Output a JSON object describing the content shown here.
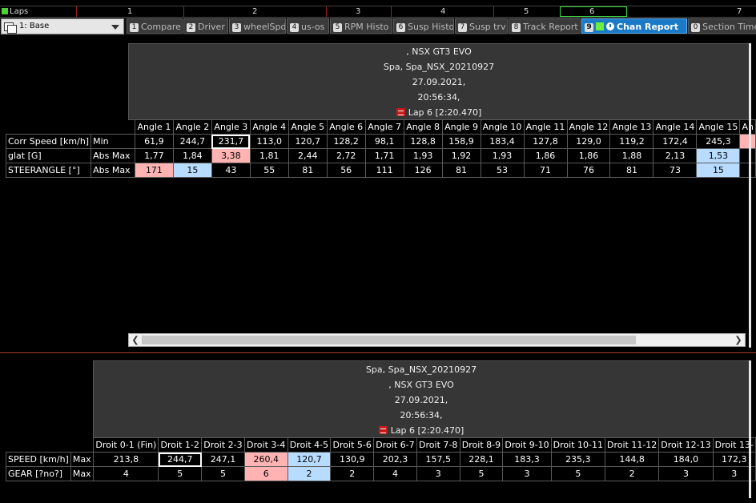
{
  "laps_bar": {
    "label": "Laps",
    "numbers": [
      "1",
      "2",
      "3",
      "4",
      "5",
      "6",
      "7"
    ]
  },
  "toolbar": {
    "config_select": "1: Base",
    "tabs": [
      {
        "num": "1",
        "label": "Compare"
      },
      {
        "num": "2",
        "label": "Driver"
      },
      {
        "num": "3",
        "label": "wheelSpd"
      },
      {
        "num": "4",
        "label": "us-os"
      },
      {
        "num": "5",
        "label": "RPM Histo"
      },
      {
        "num": "6",
        "label": "Susp Histo"
      },
      {
        "num": "7",
        "label": "Susp trv"
      },
      {
        "num": "8",
        "label": "Track Report"
      },
      {
        "num": "9",
        "label": "Chan Report"
      },
      {
        "num": "0",
        "label": "Section Times"
      }
    ]
  },
  "upper": {
    "header": {
      "car": ", NSX GT3 EVO",
      "session": "Spa, Spa_NSX_20210927",
      "date": "27.09.2021,",
      "time": "20:56:34,",
      "lap": "Lap 6   [2:20.470]"
    },
    "columns": [
      "Angle 1",
      "Angle 2",
      "Angle 3",
      "Angle 4",
      "Angle 5",
      "Angle 6",
      "Angle 7",
      "Angle 8",
      "Angle 9",
      "Angle 10",
      "Angle 11",
      "Angle 12",
      "Angle 13",
      "Angle 14",
      "Angle 15",
      "An"
    ],
    "rows": [
      {
        "channel": "Corr Speed [km/h]",
        "stat": "Min",
        "cells": [
          "61,9",
          "244,7",
          "231,7",
          "113,0",
          "120,7",
          "128,2",
          "98,1",
          "128,8",
          "158,9",
          "183,4",
          "127,8",
          "129,0",
          "119,2",
          "172,4",
          "245,3",
          ""
        ]
      },
      {
        "channel": "glat [G]",
        "stat": "Abs Max",
        "cells": [
          "1,77",
          "1,84",
          "3,38",
          "1,81",
          "2,44",
          "2,72",
          "1,71",
          "1,93",
          "1,92",
          "1,93",
          "1,86",
          "1,86",
          "1,88",
          "2,13",
          "1,53",
          ""
        ]
      },
      {
        "channel": "STEERANGLE [°]",
        "stat": "Abs Max",
        "cells": [
          "171",
          "15",
          "43",
          "55",
          "81",
          "56",
          "111",
          "126",
          "81",
          "53",
          "71",
          "76",
          "81",
          "73",
          "15",
          ""
        ]
      }
    ]
  },
  "lower": {
    "header": {
      "session": "Spa, Spa_NSX_20210927",
      "car": ", NSX GT3 EVO",
      "date": "27.09.2021,",
      "time": "20:56:34,",
      "lap": "Lap 6   [2:20.470]"
    },
    "columns": [
      "Droit 0-1 (Fin)",
      "Droit 1-2",
      "Droit 2-3",
      "Droit 3-4",
      "Droit 4-5",
      "Droit 5-6",
      "Droit 6-7",
      "Droit 7-8",
      "Droit 8-9",
      "Droit 9-10",
      "Droit 10-11",
      "Droit 11-12",
      "Droit 12-13",
      "Droit 13-"
    ],
    "rows": [
      {
        "channel": "SPEED [km/h]",
        "stat": "Max",
        "cells": [
          "213,8",
          "244,7",
          "247,1",
          "260,4",
          "120,7",
          "130,9",
          "202,3",
          "157,5",
          "228,1",
          "183,3",
          "235,3",
          "144,8",
          "184,0",
          "172,3"
        ]
      },
      {
        "channel": "GEAR [?no?]",
        "stat": "Max",
        "cells": [
          "4",
          "5",
          "5",
          "6",
          "2",
          "2",
          "4",
          "3",
          "5",
          "3",
          "5",
          "2",
          "3",
          "3"
        ]
      }
    ]
  },
  "colors": {
    "highlight_max": "#ffb3b3",
    "highlight_min": "#b7dcff",
    "active_tab": "#1a7ac8"
  }
}
